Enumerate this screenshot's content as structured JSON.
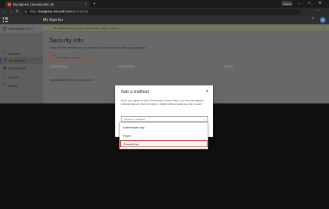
{
  "browser": {
    "tab_title": "My Sign-Ins | Security Info | Mi",
    "tab_close": "×",
    "new_tab": "+",
    "url_prefix": "https://",
    "url_host": "mysignins.microsoft.com",
    "url_path": "/security-info",
    "profile_label": "Guest",
    "min": "–",
    "max": "□",
    "close": "✕"
  },
  "header": {
    "title": "My Sign-Ins",
    "help": "?",
    "avatar_initial": "O"
  },
  "sidebar": {
    "brand": "CONTOSO",
    "brand_suffix": "demo",
    "items": [
      {
        "label": "Overview",
        "icon": "person-icon",
        "glyph": "⚇"
      },
      {
        "label": "Security info",
        "icon": "security-info-icon",
        "glyph": "⚿",
        "active": true
      },
      {
        "label": "Organizations",
        "icon": "organizations-icon",
        "glyph": "▦"
      },
      {
        "label": "Devices",
        "icon": "devices-icon",
        "glyph": "▭"
      },
      {
        "label": "Privacy",
        "icon": "lock-icon",
        "glyph": "⚲"
      }
    ]
  },
  "notice": {
    "text": "To maintain access to your account, add a sign-in method",
    "close": "×"
  },
  "main": {
    "title": "Security info",
    "description": "These are the methods you use to sign into your account or reset your password.",
    "add_method_label": "Add sign-in method",
    "lost_device_text": "Lost device?",
    "lost_device_link": "Sign out everywhere"
  },
  "modal": {
    "title": "Add a method",
    "close": "✕",
    "description": "Since you signed in with a Temporary Access Pass, you can only register methods that are used for sign-in. Which method would you like to add?",
    "select_value": "Choose a method",
    "options": [
      "Authenticator app",
      "Phone",
      "Security key"
    ]
  },
  "colors": {
    "highlight_border": "#c23a33",
    "link": "#24365f"
  }
}
